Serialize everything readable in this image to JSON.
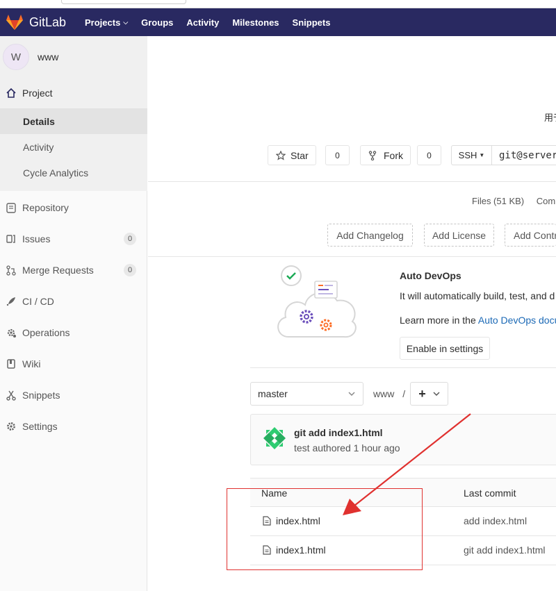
{
  "navbar": {
    "logo_text": "GitLab",
    "links": [
      {
        "label": "Projects",
        "dropdown": true
      },
      {
        "label": "Groups"
      },
      {
        "label": "Activity"
      },
      {
        "label": "Milestones"
      },
      {
        "label": "Snippets"
      }
    ]
  },
  "sidebar": {
    "avatar_letter": "W",
    "project_name": "www",
    "project_section": "Project",
    "project_sub": [
      "Details",
      "Activity",
      "Cycle Analytics"
    ],
    "items": [
      {
        "label": "Repository",
        "icon": "repository-icon"
      },
      {
        "label": "Issues",
        "icon": "issues-icon",
        "count": "0"
      },
      {
        "label": "Merge Requests",
        "icon": "merge-request-icon",
        "count": "0"
      },
      {
        "label": "CI / CD",
        "icon": "rocket-icon"
      },
      {
        "label": "Operations",
        "icon": "operations-icon"
      },
      {
        "label": "Wiki",
        "icon": "book-icon"
      },
      {
        "label": "Snippets",
        "icon": "scissors-icon"
      },
      {
        "label": "Settings",
        "icon": "gear-icon"
      }
    ]
  },
  "header": {
    "description_fragment": "用于",
    "star_label": "Star",
    "star_count": "0",
    "fork_label": "Fork",
    "fork_count": "0",
    "clone_protocol": "SSH",
    "clone_url": "git@server"
  },
  "stats": {
    "files": "Files (51 KB)",
    "commits": "Comm"
  },
  "quick_buttons": [
    "Add Changelog",
    "Add License",
    "Add Contri"
  ],
  "devops": {
    "title": "Auto DevOps",
    "text": "It will automatically build, test, and d",
    "learn_prefix": "Learn more in the ",
    "learn_link": "Auto DevOps docu",
    "button": "Enable in settings"
  },
  "tree": {
    "branch": "master",
    "path": "www",
    "separator": "/",
    "plus": "+"
  },
  "last_commit": {
    "message": "git add index1.html",
    "meta": "test authored 1 hour ago"
  },
  "files_table": {
    "col_name": "Name",
    "col_commit": "Last commit",
    "rows": [
      {
        "name": "index.html",
        "commit": "add index.html"
      },
      {
        "name": "index1.html",
        "commit": "git add index1.html"
      }
    ]
  },
  "colors": {
    "navbar": "#292961",
    "annotation": "#e0312f",
    "link": "#1b69b6"
  }
}
